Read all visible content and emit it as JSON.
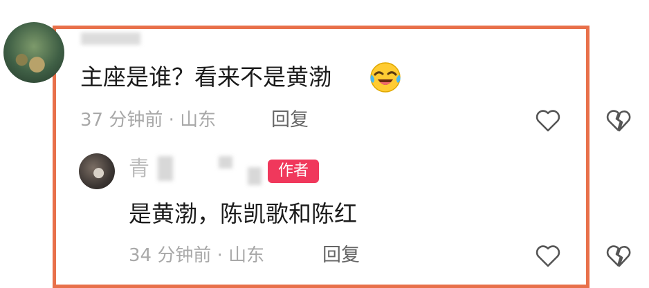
{
  "comment": {
    "text": "主座是谁？看来不是黄渤",
    "emoji": "laughing-crying-emoji",
    "meta": "37 分钟前 · 山东",
    "reply_label": "回复"
  },
  "reply": {
    "author_badge": "作者",
    "name_fragment": "青",
    "text": "是黄渤，陈凯歌和陈红",
    "meta": "34 分钟前 · 山东",
    "reply_label": "回复"
  },
  "colors": {
    "highlight_border": "#e8704a",
    "badge": "#f0385c",
    "meta_text": "#a8a8a8"
  },
  "icons": [
    "heart-outline-icon",
    "broken-heart-icon"
  ]
}
